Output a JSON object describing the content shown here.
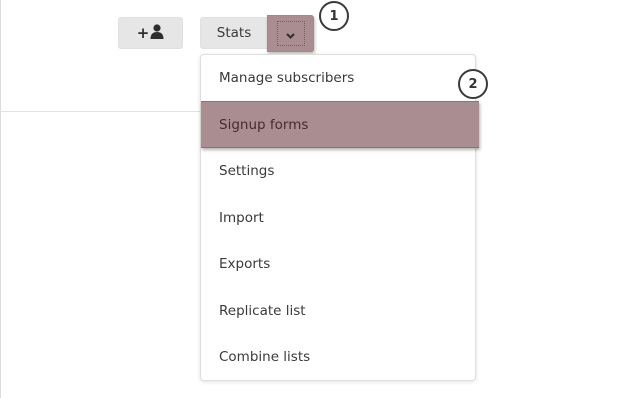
{
  "toolbar": {
    "add_icon_plus": "+",
    "add_icon": "add-user-icon",
    "stats_label": "Stats",
    "dropdown_toggle_icon": "chevron-down-icon"
  },
  "callouts": {
    "one": "1",
    "two": "2"
  },
  "menu": {
    "items": [
      {
        "label": "Manage subscribers",
        "highlighted": false
      },
      {
        "label": "Signup forms",
        "highlighted": true
      },
      {
        "label": "Settings",
        "highlighted": false
      },
      {
        "label": "Import",
        "highlighted": false
      },
      {
        "label": "Exports",
        "highlighted": false
      },
      {
        "label": "Replicate list",
        "highlighted": false
      },
      {
        "label": "Combine lists",
        "highlighted": false
      }
    ]
  },
  "colors": {
    "highlight": "#a98d91",
    "button": "#e6e6e6"
  }
}
